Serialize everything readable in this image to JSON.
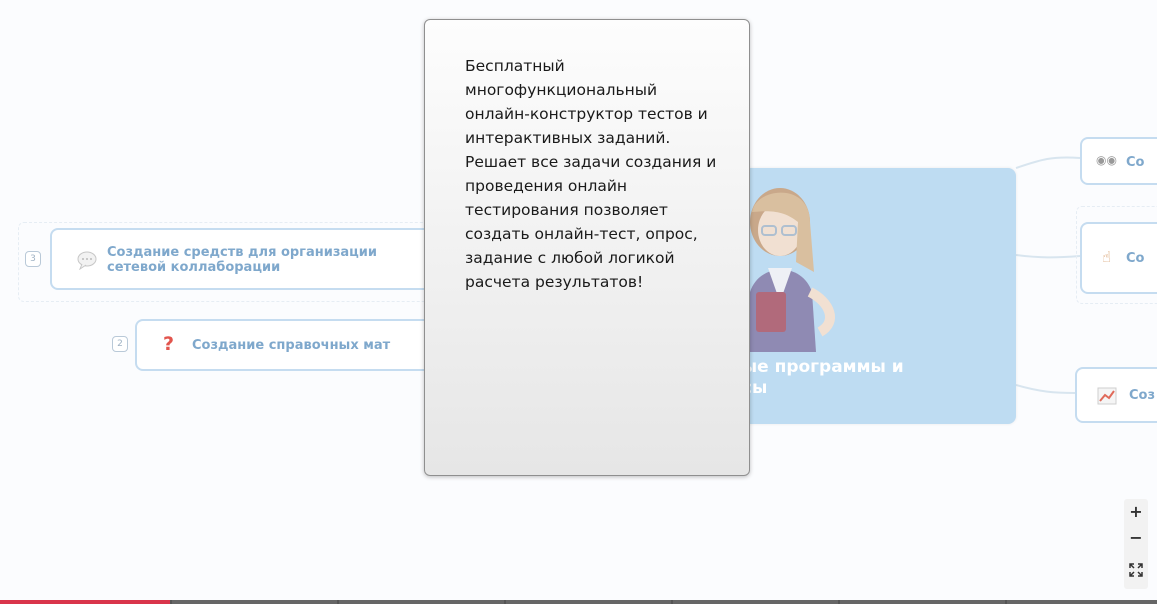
{
  "left_nodes": [
    {
      "badge": "3",
      "label": "Создание средств для организации сетевой коллаборации",
      "icon": "speech-bubble-icon"
    },
    {
      "badge": "2",
      "label": "Создание справочных мат",
      "icon": "question-icon"
    }
  ],
  "center": {
    "title": "ные программы и\nисы",
    "illustration": "woman-teacher-illustration"
  },
  "right_nodes": [
    {
      "label": "Со",
      "icon": "eyes-icon"
    },
    {
      "label": "Со",
      "icon": "pointing-hand-icon"
    },
    {
      "label": "Соз",
      "icon": "chart-icon"
    }
  ],
  "tooltip": {
    "text": "Бесплатный многофункциональный онлайн-конструктор тестов и интерактивных заданий. Решает все задачи создания и проведения онлайн тестирования позволяет создать онлайн-тест, опрос, задание с любой логикой расчета результатов!"
  },
  "zoom": {
    "plus": "+",
    "minus": "−",
    "fit_icon": "fit-to-screen-icon"
  },
  "colors": {
    "node_border": "#c5dcf0",
    "node_text": "#7fa8cc",
    "center_bg": "#bedcf2",
    "footer_active": "#d9354b"
  }
}
